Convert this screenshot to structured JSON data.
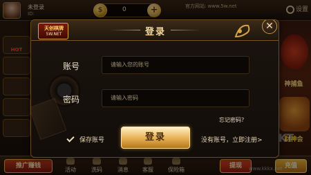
{
  "topbar": {
    "nickname": "未登录",
    "uid": "ID:",
    "coins": "0",
    "site_label": "官方网站: ",
    "site_url": "www.5w.net",
    "settings_label": "设置"
  },
  "sidebar": {
    "hot_label": "HOT"
  },
  "right_promos": {
    "fish_label": "神捕鱼",
    "fortune_label": "财神会"
  },
  "bottombar": {
    "promo_label": "推广赚钱",
    "items": [
      {
        "label": "活动"
      },
      {
        "label": "洗码"
      },
      {
        "label": "消息"
      },
      {
        "label": "客服"
      },
      {
        "label": "保险箱"
      }
    ],
    "withdraw_label": "提现",
    "recharge_label": "充值"
  },
  "watermark": {
    "line1": "KKKT",
    "line2": "www.kkkx.net"
  },
  "dialog": {
    "title": "登录",
    "brand_line1": "天创棋牌",
    "brand_line2": "5W.NET",
    "account_label": "账号",
    "account_placeholder": "请输入您的账号",
    "password_label": "密码",
    "password_placeholder": "请输入密码",
    "forgot_label": "忘记密码？",
    "remember_label": "保存账号",
    "login_label": "登录",
    "register_label": "没有账号，立即注册>"
  },
  "colors": {
    "accent_gold": "#e9b45a",
    "panel_bg": "#120d09"
  }
}
